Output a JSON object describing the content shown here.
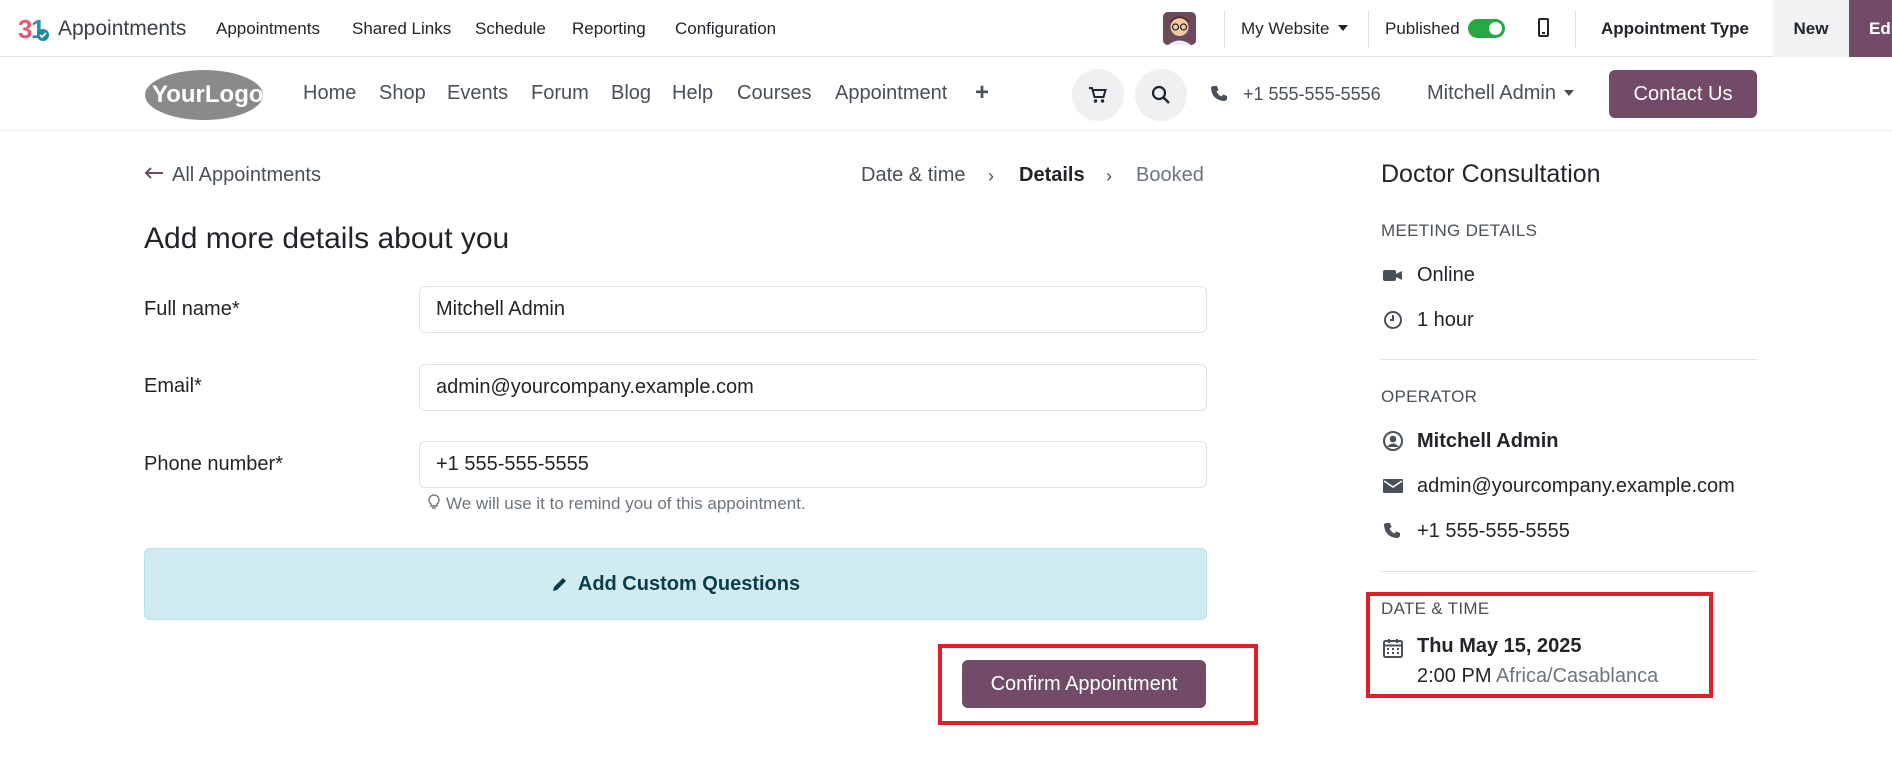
{
  "topbar": {
    "app_name": "Appointments",
    "menu": [
      "Appointments",
      "Shared Links",
      "Schedule",
      "Reporting",
      "Configuration"
    ],
    "website_selector": "My Website",
    "published_label": "Published",
    "appointment_type": "Appointment Type",
    "new_label": "New",
    "edit_label": "Edit"
  },
  "site": {
    "logo_text": "YourLogo",
    "nav": [
      "Home",
      "Shop",
      "Events",
      "Forum",
      "Blog",
      "Help",
      "Courses",
      "Appointment"
    ],
    "phone": "+1 555-555-5556",
    "user": "Mitchell Admin",
    "contact": "Contact Us"
  },
  "main": {
    "back_label": "All Appointments",
    "steps": [
      "Date & time",
      "Details",
      "Booked"
    ],
    "heading": "Add more details about you",
    "fields": {
      "full_name_label": "Full name*",
      "full_name_value": "Mitchell Admin",
      "email_label": "Email*",
      "email_value": "admin@yourcompany.example.com",
      "phone_label": "Phone number*",
      "phone_value": "+1 555-555-5555",
      "phone_hint": "We will use it to remind you of this appointment."
    },
    "custom_questions": "Add Custom Questions",
    "confirm": "Confirm Appointment"
  },
  "sidebar": {
    "title": "Doctor Consultation",
    "meeting_caption": "MEETING DETAILS",
    "location": "Online",
    "duration": "1 hour",
    "operator_caption": "OPERATOR",
    "operator_name": "Mitchell Admin",
    "operator_email": "admin@yourcompany.example.com",
    "operator_phone": "+1 555-555-5555",
    "datetime_caption": "DATE & TIME",
    "date": "Thu May 15, 2025",
    "time": "2:00 PM",
    "timezone": "Africa/Casablanca"
  },
  "colors": {
    "brand": "#714b67",
    "toggle_on": "#28a745",
    "info_bg": "#d1ecf1",
    "highlight": "#e01f2a"
  }
}
